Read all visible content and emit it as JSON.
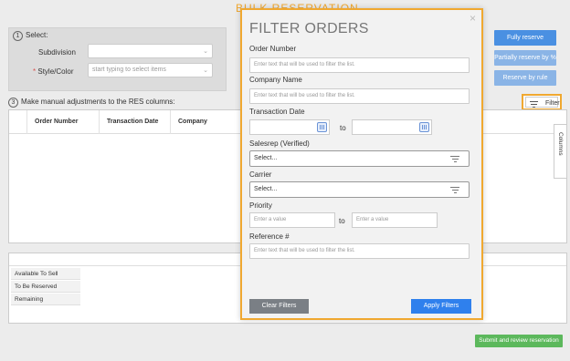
{
  "page": {
    "title": "BULK RESERVATION"
  },
  "select_section": {
    "number": "1",
    "label": "Select:",
    "subdivision_label": "Subdivision",
    "style_label": "Style/Color",
    "style_required_mark": "*",
    "style_placeholder": "start typing to select items"
  },
  "reserve_buttons": {
    "fully": "Fully reserve",
    "partially": "Partially reserve by %",
    "by_rule": "Reserve by rule"
  },
  "adjust_section": {
    "number": "3",
    "label": "Make manual adjustments to the RES columns:",
    "filter_button": "Filter"
  },
  "grid": {
    "columns": [
      "Order Number",
      "Transaction Date",
      "Company"
    ],
    "columns_tab": "Columns"
  },
  "summary_grid": {
    "rows": [
      "Available To Sell",
      "To Be Reserved",
      "Remaining"
    ]
  },
  "submit_button": "Submit and review reservation",
  "filter_modal": {
    "title": "FILTER ORDERS",
    "close": "×",
    "order_number_label": "Order Number",
    "order_number_placeholder": "Enter text that will be used to filter the list.",
    "company_label": "Company Name",
    "company_placeholder": "Enter text that will be used to filter the list.",
    "transaction_date_label": "Transaction Date",
    "date_to": "to",
    "salesrep_label": "Salesrep (Verified)",
    "salesrep_value": "Select...",
    "carrier_label": "Carrier",
    "carrier_value": "Select...",
    "priority_label": "Priority",
    "priority_from_placeholder": "Enter a value",
    "priority_to": "to",
    "priority_to_placeholder": "Enter a value",
    "reference_label": "Reference #",
    "reference_placeholder": "Enter text that will be used to filter the list.",
    "clear_button": "Clear Filters",
    "apply_button": "Apply Filters"
  },
  "colors": {
    "accent": "#f0a830",
    "primary_button": "#4a90e2",
    "apply_button": "#2f80ed",
    "submit_button": "#5cb85c"
  }
}
